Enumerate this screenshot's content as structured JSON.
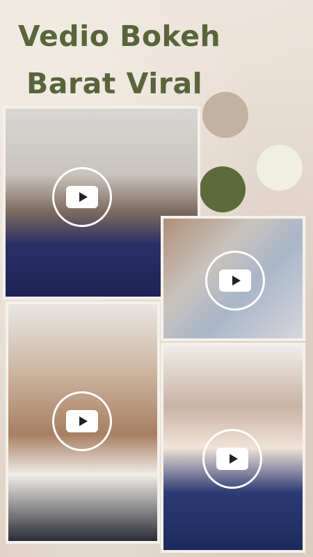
{
  "banner": {
    "title_line1": "Vedio Bokeh",
    "title_line2": "Barat Viral"
  },
  "colors": {
    "title": "#58653a",
    "swatch_tan": "#c3b2a1",
    "swatch_green": "#5d6a3c",
    "swatch_cream": "#f1eee2",
    "background": "#e6dbd0"
  },
  "photos": [
    {
      "icon": "play-icon"
    },
    {
      "icon": "play-icon"
    },
    {
      "icon": "play-icon"
    },
    {
      "icon": "play-icon"
    }
  ]
}
